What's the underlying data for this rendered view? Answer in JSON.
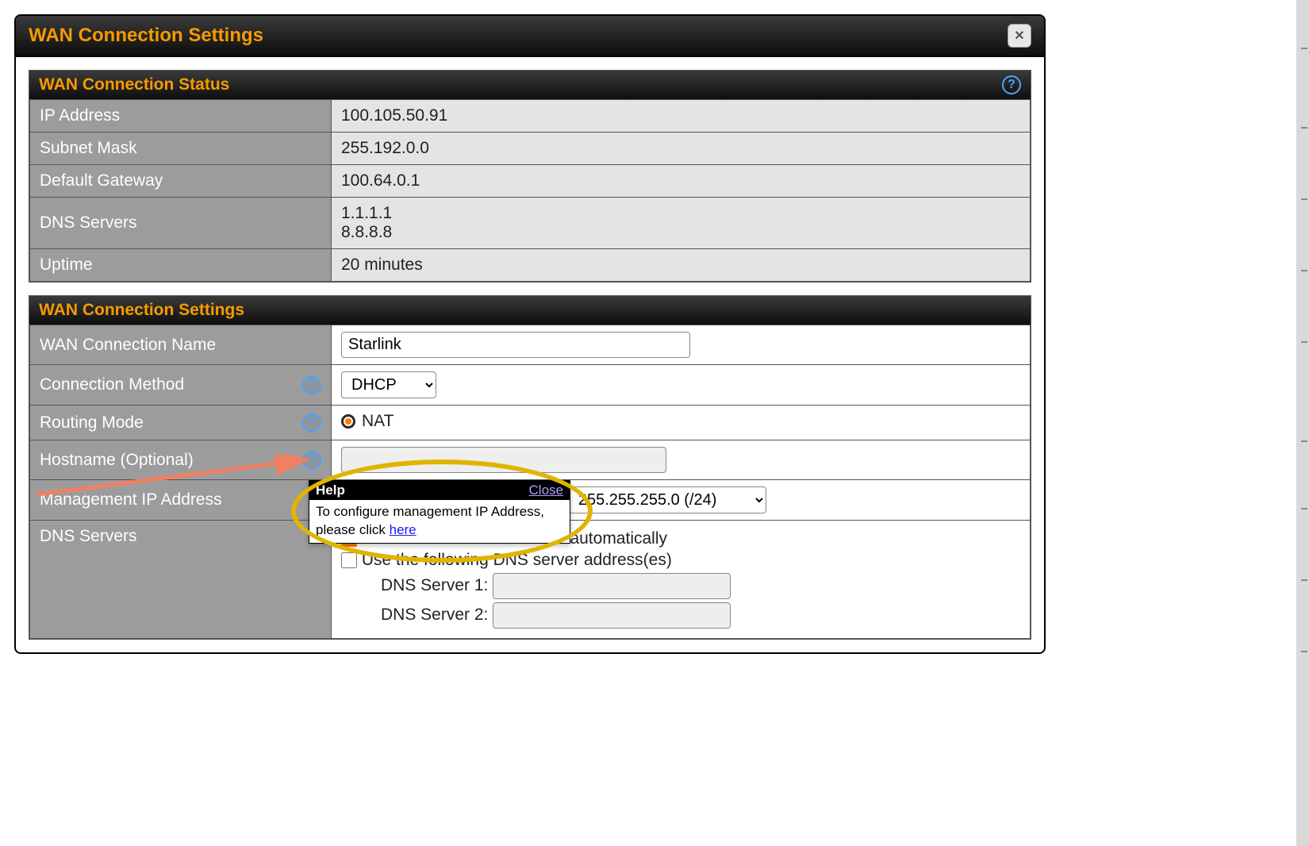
{
  "dialog": {
    "title": "WAN Connection Settings"
  },
  "status": {
    "title": "WAN Connection Status",
    "rows": {
      "ip_label": "IP Address",
      "ip_value": "100.105.50.91",
      "subnet_label": "Subnet Mask",
      "subnet_value": "255.192.0.0",
      "gw_label": "Default Gateway",
      "gw_value": "100.64.0.1",
      "dns_label": "DNS Servers",
      "dns_value": "1.1.1.1\n8.8.8.8",
      "uptime_label": "Uptime",
      "uptime_value": "20 minutes"
    }
  },
  "settings": {
    "title": "WAN Connection Settings",
    "rows": {
      "name_label": "WAN Connection Name",
      "name_value": "Starlink",
      "method_label": "Connection Method",
      "method_value": "DHCP",
      "routing_label": "Routing Mode",
      "routing_value": "NAT",
      "hostname_label": "Hostname (Optional)",
      "hostname_value": "",
      "mgmt_label": "Management IP Address",
      "mgmt_subnet": "255.255.255.0 (/24)",
      "dns_label": "DNS Servers",
      "dns_auto_label": "Obtain DNS server address automatically",
      "dns_manual_label": "Use the following DNS server address(es)",
      "dns1_label": "DNS Server 1:",
      "dns1_value": "",
      "dns2_label": "DNS Server 2:",
      "dns2_value": ""
    }
  },
  "help_popup": {
    "title": "Help",
    "close": "Close",
    "text_prefix": "To configure management IP Address, please click ",
    "link_text": "here"
  }
}
